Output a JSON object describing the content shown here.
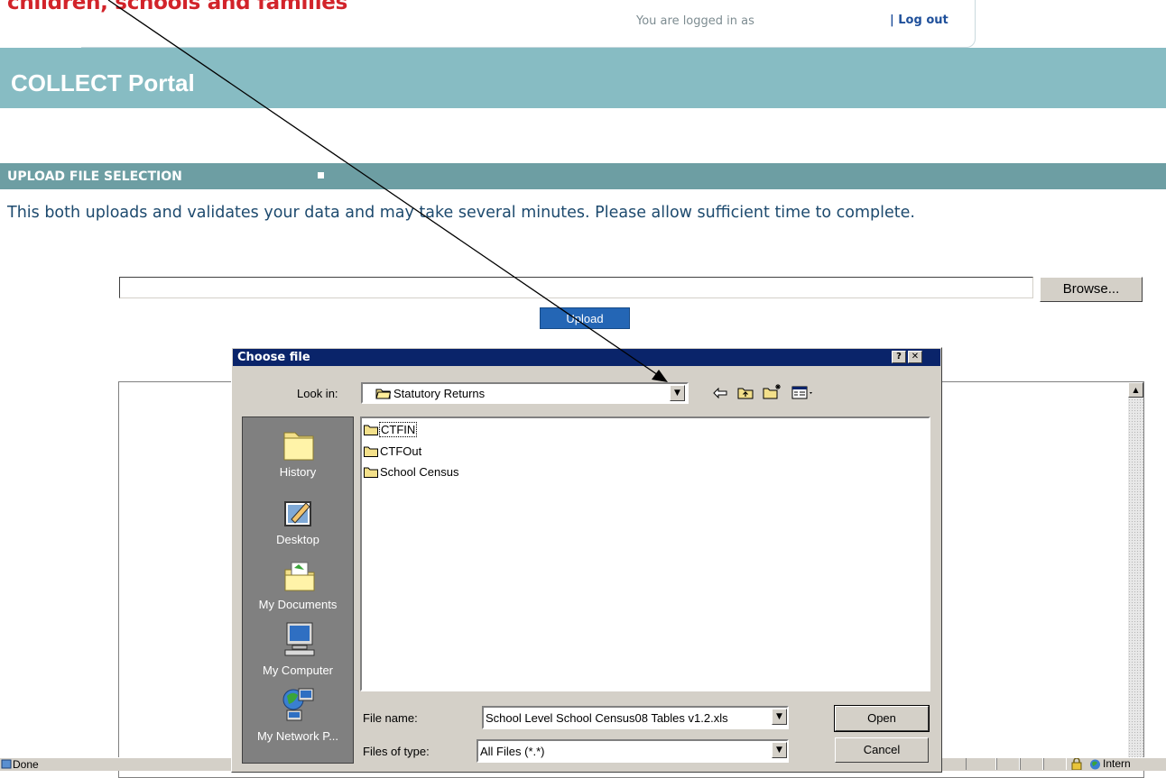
{
  "header": {
    "brand": "children, schools and families",
    "logged_in_text": "You are logged in as",
    "logout_label": "| Log out",
    "portal_title": "COLLECT Portal"
  },
  "section": {
    "title": "UPLOAD FILE SELECTION",
    "instruction": "This both uploads and validates your data and may take several minutes. Please allow sufficient time to complete."
  },
  "form": {
    "file_path_value": "",
    "browse_label": "Browse...",
    "upload_label": "Upload"
  },
  "dialog": {
    "title": "Choose file",
    "help_label": "?",
    "close_label": "✕",
    "look_in_label": "Look in:",
    "look_in_value": "Statutory Returns",
    "places": [
      "History",
      "Desktop",
      "My Documents",
      "My Computer",
      "My Network P..."
    ],
    "files": [
      "CTFIN",
      "CTFOut",
      "School Census"
    ],
    "file_name_label": "File name:",
    "file_name_value": "School Level School Census08 Tables v1.2.xls",
    "files_of_type_label": "Files of type:",
    "files_of_type_value": "All Files (*.*)",
    "open_label": "Open",
    "cancel_label": "Cancel"
  },
  "statusbar": {
    "text": "Done",
    "zone": "Intern"
  },
  "colors": {
    "brand_red": "#d2232a",
    "portal_band": "#87bcc3",
    "section_bar": "#6d9ea3",
    "dialog_title": "#0a246a",
    "upload_button": "#2466b5"
  },
  "icons": [
    "folder-icon",
    "up-folder-icon",
    "back-arrow-icon",
    "new-folder-icon",
    "view-menu-icon",
    "history-icon",
    "desktop-icon",
    "my-documents-icon",
    "my-computer-icon",
    "network-icon"
  ]
}
